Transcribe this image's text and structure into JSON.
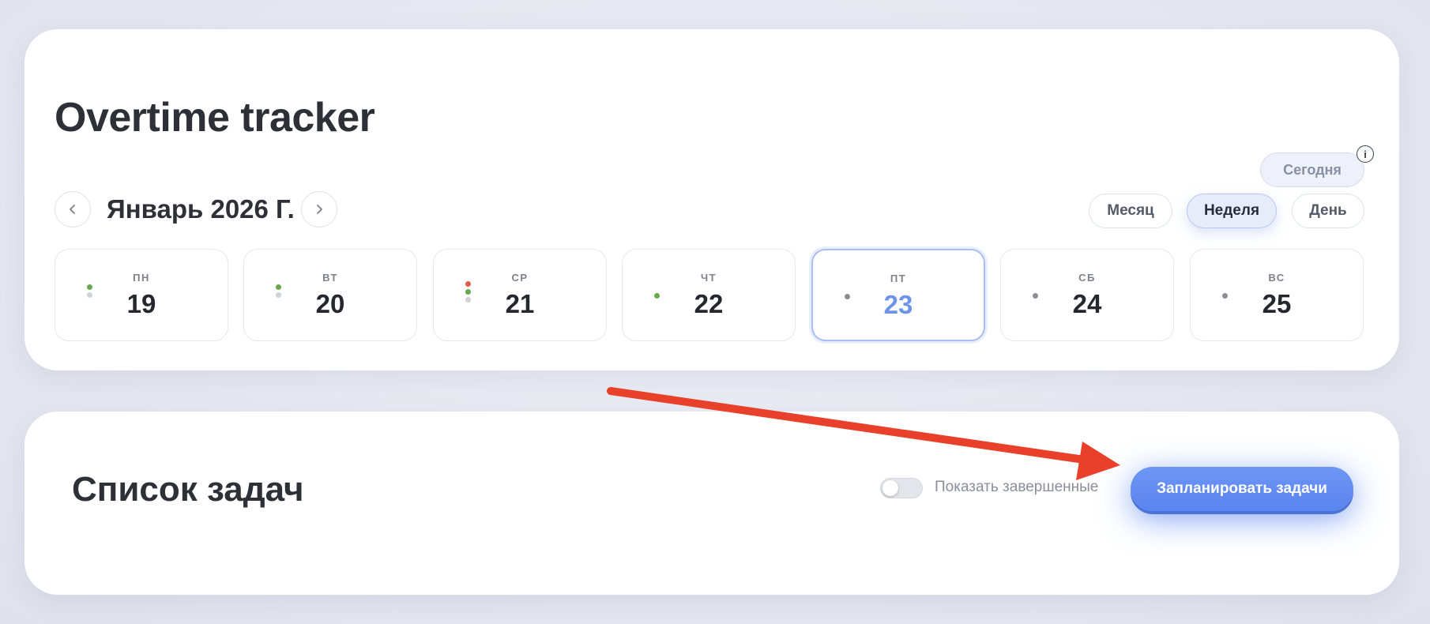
{
  "header": {
    "title": "Overtime tracker"
  },
  "calendar": {
    "month_label": "Январь 2026 Г.",
    "today_label": "Сегодня",
    "info_glyph": "i",
    "views": {
      "month": "Месяц",
      "week": "Неделя",
      "day": "День",
      "active": "Неделя"
    },
    "days": [
      {
        "weekday": "ПН",
        "num": "19",
        "dots": [
          "#6aa84f",
          "#d0d2d8"
        ]
      },
      {
        "weekday": "ВТ",
        "num": "20",
        "dots": [
          "#6aa84f",
          "#d0d2d8"
        ]
      },
      {
        "weekday": "СР",
        "num": "21",
        "dots": [
          "#e45a4a",
          "#6aa84f",
          "#d0d2d8"
        ]
      },
      {
        "weekday": "ЧТ",
        "num": "22",
        "dots": [
          "#6aa84f"
        ]
      },
      {
        "weekday": "ПТ",
        "num": "23",
        "dots": [
          "#8a8d96"
        ],
        "selected": true
      },
      {
        "weekday": "СБ",
        "num": "24",
        "dots": [
          "#8a8d96"
        ]
      },
      {
        "weekday": "ВС",
        "num": "25",
        "dots": [
          "#8a8d96"
        ]
      }
    ]
  },
  "tasks": {
    "title": "Список задач",
    "toggle_label": "Показать завершенные",
    "toggle_on": false,
    "plan_button": "Запланировать задачи"
  },
  "colors": {
    "accent": "#5a84ef",
    "arrow": "#e8402a",
    "selected_day": "#6e94ea"
  },
  "icons": {
    "prev": "chevron-left-icon",
    "next": "chevron-right-icon",
    "info": "info-icon"
  }
}
